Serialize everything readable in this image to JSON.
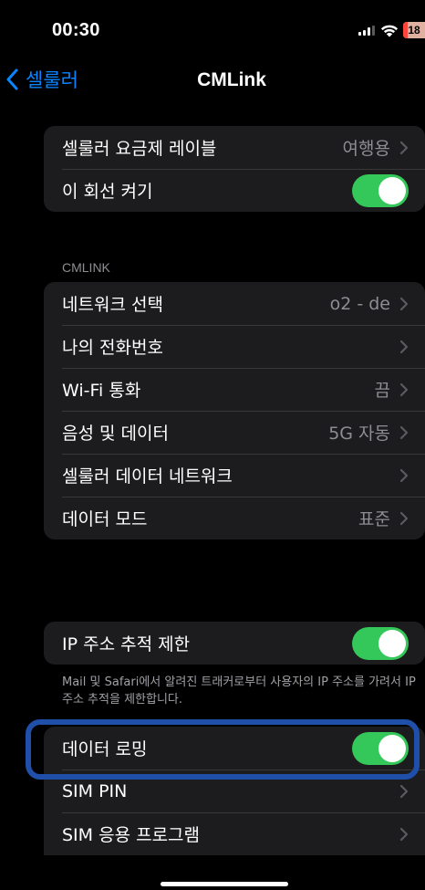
{
  "status_bar": {
    "time": "00:30",
    "battery": "18",
    "battery_color": "#ff453a"
  },
  "nav": {
    "back_label": "셀룰러",
    "title": "CMLink"
  },
  "group1": {
    "rows": [
      {
        "label": "셀룰러 요금제 레이블",
        "value": "여행용"
      },
      {
        "label": "이 회선 켜기",
        "toggle": true
      }
    ]
  },
  "section_header": "CMLINK",
  "group2": {
    "rows": [
      {
        "label": "네트워크 선택",
        "value": "o2 - de"
      },
      {
        "label": "나의 전화번호",
        "value": ""
      },
      {
        "label": "Wi-Fi 통화",
        "value": "끔"
      },
      {
        "label": "음성 및 데이터",
        "value": "5G 자동"
      },
      {
        "label": "셀룰러 데이터 네트워크",
        "value": ""
      },
      {
        "label": "데이터 모드",
        "value": "표준"
      }
    ]
  },
  "group3": {
    "label": "IP 주소 추적 제한",
    "toggle": true,
    "note": "Mail 및 Safari에서 알려진 트래커로부터 사용자의 IP 주소를 가려서 IP 주소 추적을 제한합니다."
  },
  "group4": {
    "rows": [
      {
        "label": "데이터 로밍",
        "toggle": true,
        "highlighted": true
      },
      {
        "label": "SIM PIN",
        "value": ""
      },
      {
        "label": "SIM 응용 프로그램",
        "value": ""
      }
    ]
  },
  "colors": {
    "accent": "#0a84ff",
    "toggle_on": "#34c759",
    "highlight_border": "#1f4fa8"
  }
}
